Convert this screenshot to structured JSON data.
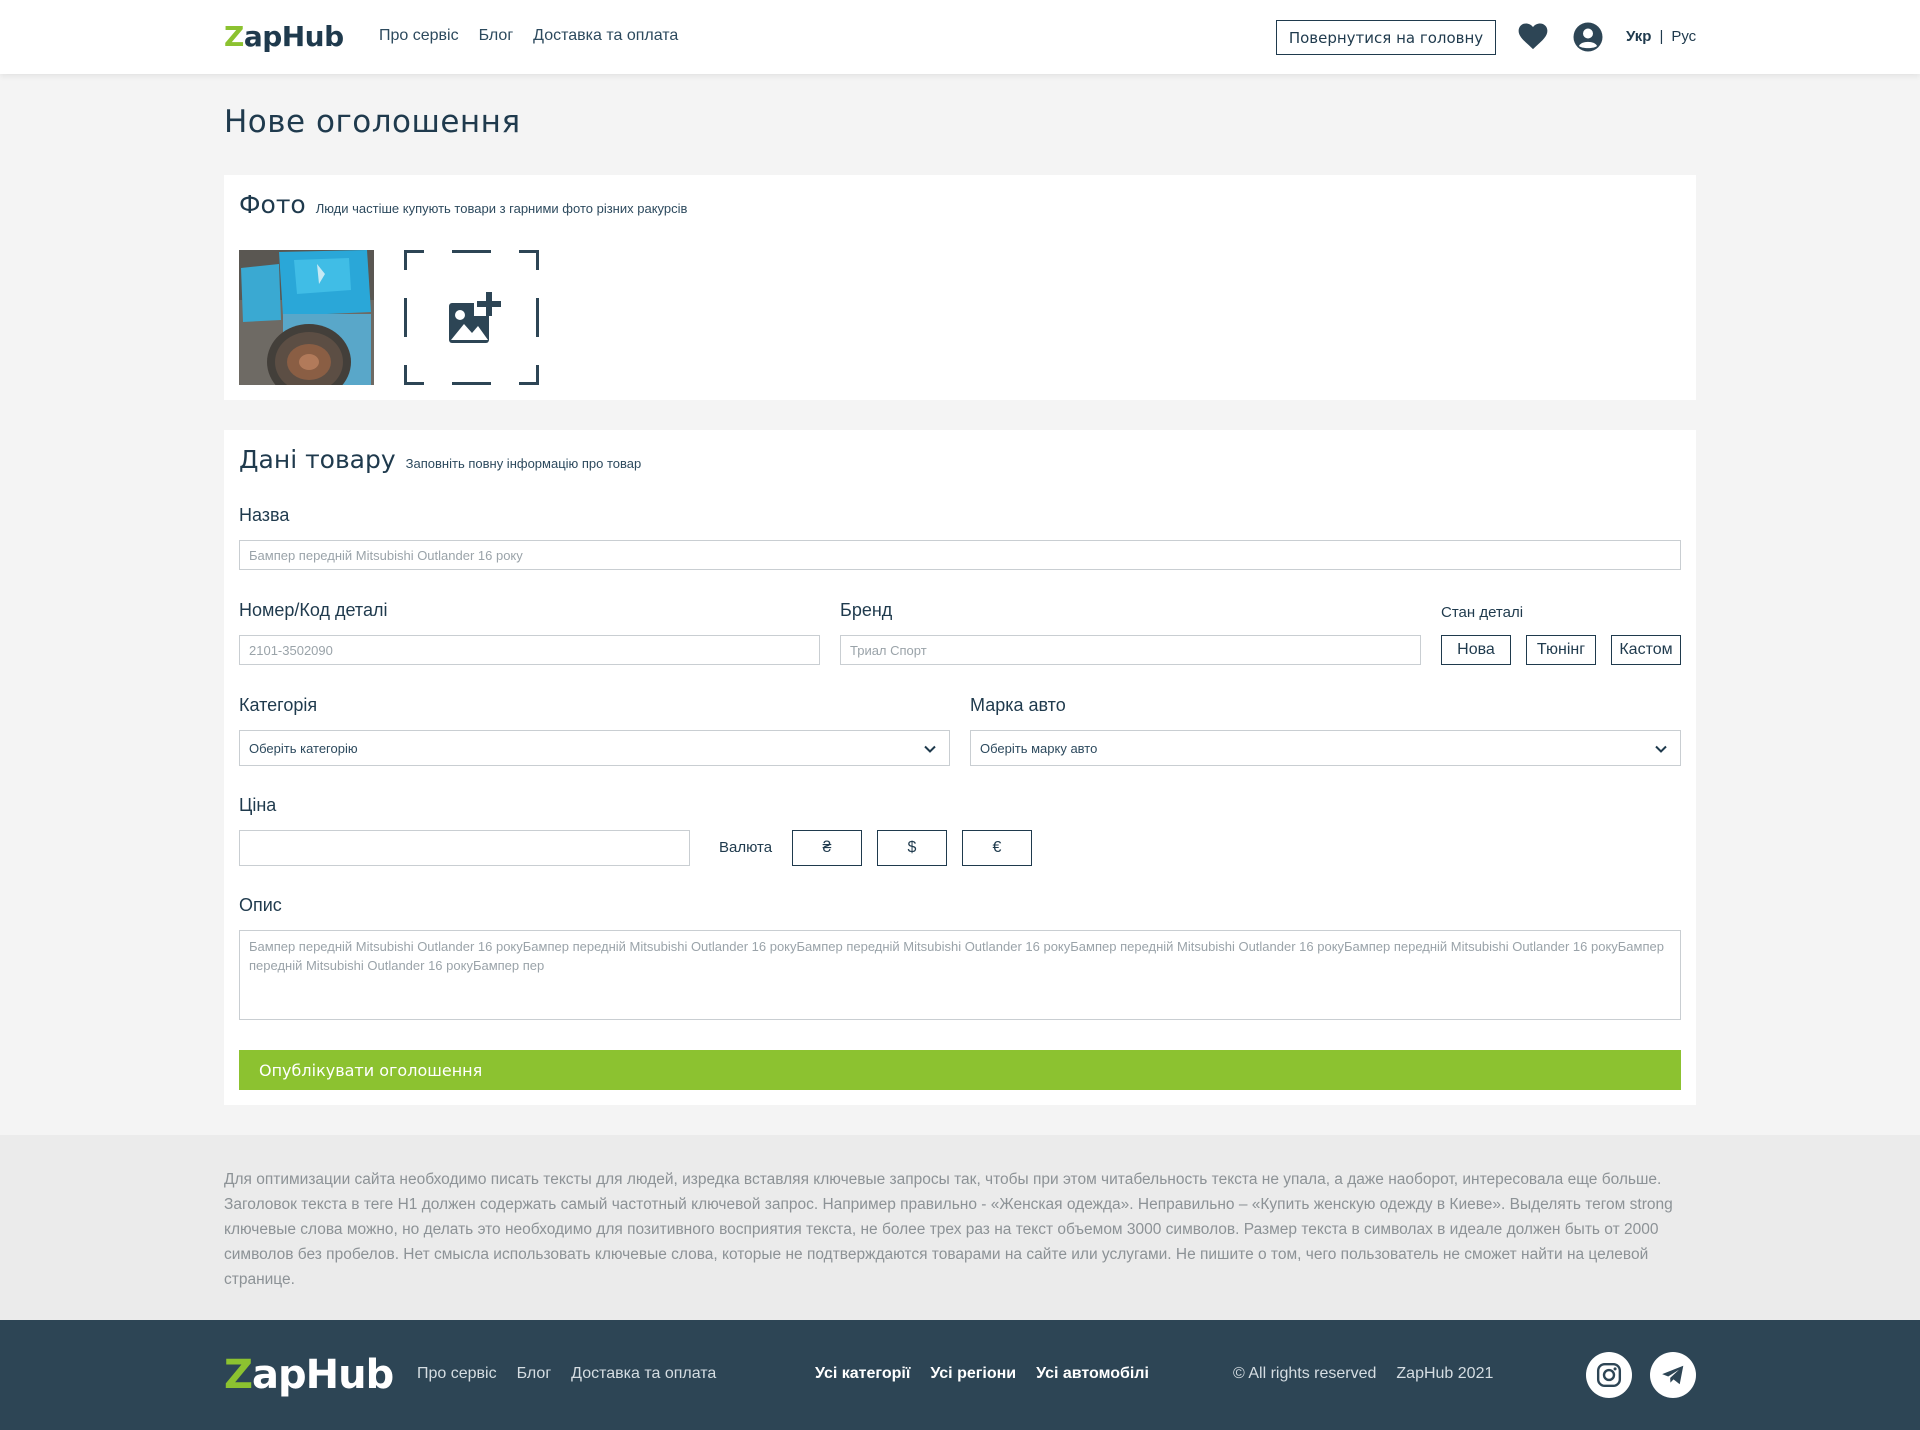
{
  "header": {
    "logo": {
      "first": "Z",
      "rest": "apHub"
    },
    "nav": [
      "Про сервіс",
      "Блог",
      "Доставка та оплата"
    ],
    "back_button": "Повернутися на головну",
    "lang": {
      "active": "Укр",
      "separator": "|",
      "other": "Рус"
    }
  },
  "page_title": "Нове оголошення",
  "photo_section": {
    "title": "Фото",
    "subtitle": "Люди частіше купують товари з гарними фото різних ракурсів"
  },
  "product_section": {
    "title": "Дані товару",
    "subtitle": "Заповніть повну інформацію про товар",
    "name": {
      "label": "Назва",
      "placeholder": "Бампер передній Mitsubishi Outlander 16 року"
    },
    "part_number": {
      "label": "Номер/Код деталі",
      "placeholder": "2101-3502090"
    },
    "brand": {
      "label": "Бренд",
      "placeholder": "Триал Спорт"
    },
    "condition": {
      "label": "Стан деталі",
      "options": [
        "Нова",
        "Тюнінг",
        "Кастом"
      ]
    },
    "category": {
      "label": "Категорія",
      "value": "Оберіть категорію"
    },
    "car_make": {
      "label": "Марка авто",
      "value": "Оберіть марку авто"
    },
    "price": {
      "label": "Ціна",
      "value": ""
    },
    "currency": {
      "label": "Валюта",
      "options": [
        "₴",
        "$",
        "€"
      ]
    },
    "description": {
      "label": "Опис",
      "placeholder": "Бампер передній Mitsubishi Outlander 16 рокуБампер передній Mitsubishi Outlander 16 рокуБампер передній Mitsubishi Outlander 16 рокуБампер передній Mitsubishi Outlander 16 рокуБампер передній Mitsubishi Outlander 16 рокуБампер передній Mitsubishi Outlander 16 рокуБампер пер"
    },
    "publish_button": "Опублікувати оголошення"
  },
  "seo_text": "Для оптимизации сайта необходимо писать тексты для людей, изредка вставляя ключевые запросы так, чтобы при этом читабельность текста не упала, а даже наоборот, интересовала еще больше. Заголовок текста в теге H1 должен содержать самый частотный ключевой запрос. Например правильно - «Женская одежда». Неправильно – «Купить женскую одежду в Киеве». Выделять тегом strong ключевые слова можно, но делать это необходимо для позитивного восприятия текста, не более трех раз на текст объемом 3000 символов. Размер текста в символах в идеале должен быть от 2000 символов без пробелов. Нет смысла использовать ключевые слова, которые не подтверждаются товарами на сайте или услугами. Не пишите о том, чего пользователь не сможет найти на целевой странице.",
  "footer": {
    "logo": {
      "first": "Z",
      "rest": "apHub"
    },
    "nav": [
      "Про сервіс",
      "Блог",
      "Доставка та оплата"
    ],
    "catalog_links": [
      "Усі категорії",
      "Усі регіони",
      "Усі автомобілі"
    ],
    "copyright": "© All rights reserved",
    "brand_year": "ZapHub 2021"
  },
  "icons": [
    "heart-icon",
    "user-icon",
    "add-photo-icon",
    "chevron-down-icon",
    "instagram-icon",
    "telegram-icon"
  ],
  "colors": {
    "accent": "#8cc230",
    "primary": "#1f3a4d",
    "footer_bg": "#2d4555"
  }
}
